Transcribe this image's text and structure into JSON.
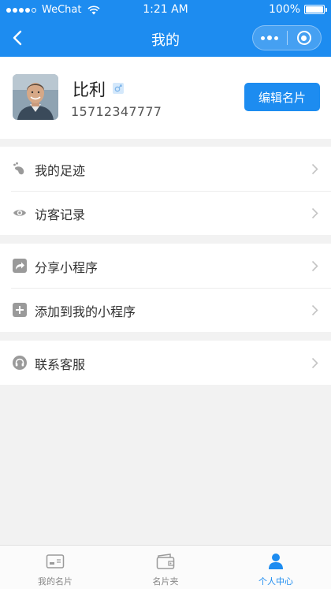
{
  "status_bar": {
    "carrier": "WeChat",
    "time": "1:21 AM",
    "battery": "100%"
  },
  "nav": {
    "title": "我的",
    "back_icon": "chevron-left-icon",
    "more_icon": "more-dots-icon",
    "close_icon": "miniprogram-close-icon"
  },
  "profile": {
    "name": "比利",
    "gender_icon": "male-icon",
    "phone": "15712347777",
    "edit_button": "编辑名片"
  },
  "menu_groups": [
    [
      {
        "label": "我的足迹",
        "icon": "footprint-icon"
      },
      {
        "label": "访客记录",
        "icon": "eye-icon"
      }
    ],
    [
      {
        "label": "分享小程序",
        "icon": "share-icon"
      },
      {
        "label": "添加到我的小程序",
        "icon": "add-icon"
      }
    ],
    [
      {
        "label": "联系客服",
        "icon": "headset-icon"
      }
    ]
  ],
  "tabs": [
    {
      "label": "我的名片",
      "icon": "business-card-icon",
      "active": false
    },
    {
      "label": "名片夹",
      "icon": "card-holder-icon",
      "active": false
    },
    {
      "label": "个人中心",
      "icon": "user-icon",
      "active": true
    }
  ],
  "colors": {
    "primary": "#1d8cf0",
    "background": "#f2f2f2",
    "icon_gray": "#9a9a9a"
  }
}
